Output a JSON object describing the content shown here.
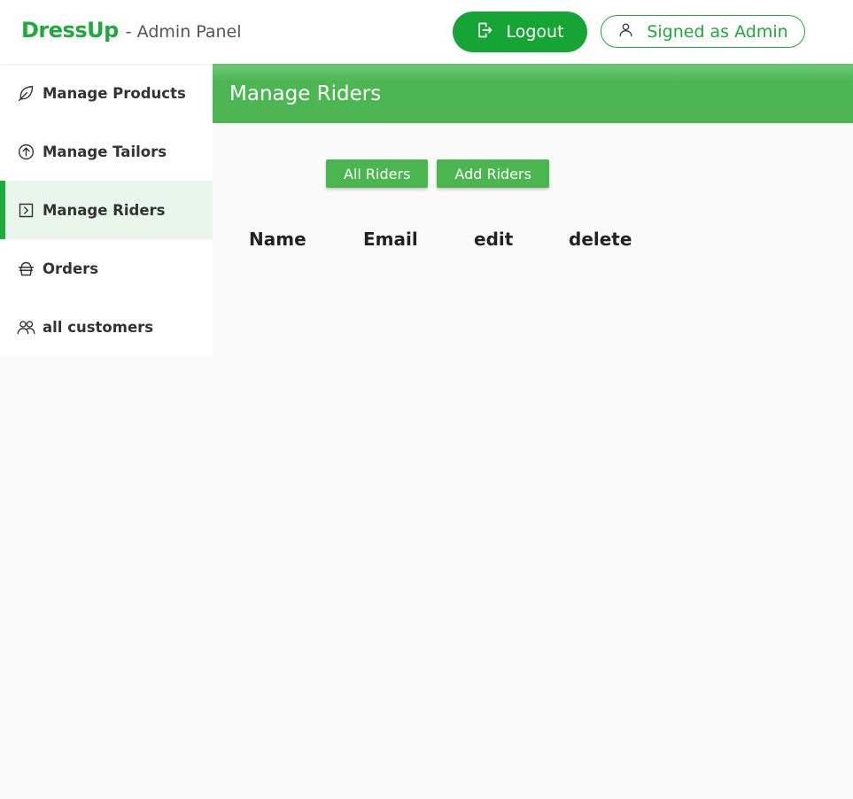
{
  "header": {
    "brand": "DressUp",
    "subtitle": "- Admin Panel",
    "logout_label": "Logout",
    "signed_label": "Signed as Admin"
  },
  "sidebar": {
    "items": [
      {
        "label": "Manage Products",
        "icon": "leaf-icon"
      },
      {
        "label": "Manage Tailors",
        "icon": "arrow-up-circle-icon"
      },
      {
        "label": "Manage Riders",
        "icon": "chevron-right-square-icon",
        "active": true
      },
      {
        "label": "Orders",
        "icon": "basket-icon"
      },
      {
        "label": "all customers",
        "icon": "users-icon"
      }
    ]
  },
  "main": {
    "title": "Manage Riders",
    "tabs": [
      "All Riders",
      "Add Riders"
    ],
    "columns": [
      "Name",
      "Email",
      "edit",
      "delete"
    ]
  },
  "colors": {
    "brand": "#1faa3c",
    "accent": "#4bb550",
    "active_bg": "#e9f6ec"
  }
}
